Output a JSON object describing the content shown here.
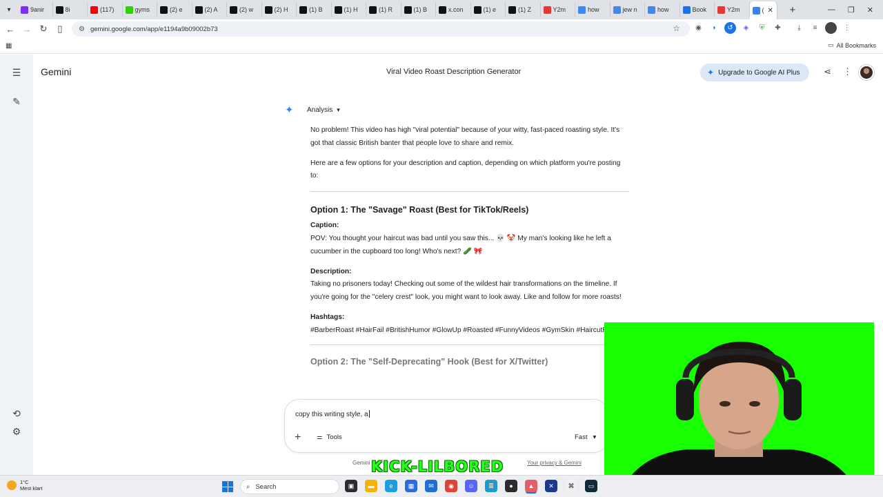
{
  "browser": {
    "tabs": [
      {
        "label": "9anir",
        "icon": "play-icon",
        "color": "#7b2ff7"
      },
      {
        "label": "8i",
        "icon": "tiktok-icon",
        "color": "#111111"
      },
      {
        "label": "(117)",
        "icon": "youtube-icon",
        "color": "#ff0000"
      },
      {
        "label": "gyms",
        "icon": "kick-icon",
        "color": "#2bd400"
      },
      {
        "label": "(2) e",
        "icon": "x-icon",
        "color": "#111111"
      },
      {
        "label": "(2) A",
        "icon": "x-icon",
        "color": "#111111"
      },
      {
        "label": "(2) w",
        "icon": "x-icon",
        "color": "#111111"
      },
      {
        "label": "(2) H",
        "icon": "x-icon",
        "color": "#111111"
      },
      {
        "label": "(1) B",
        "icon": "x-icon",
        "color": "#111111"
      },
      {
        "label": "(1) H",
        "icon": "x-icon",
        "color": "#111111"
      },
      {
        "label": "(1) R",
        "icon": "x-icon",
        "color": "#111111"
      },
      {
        "label": "(1) B",
        "icon": "x-icon",
        "color": "#111111"
      },
      {
        "label": "x.con",
        "icon": "x-icon",
        "color": "#111111"
      },
      {
        "label": "(1) e",
        "icon": "x-icon",
        "color": "#111111"
      },
      {
        "label": "(1) Z",
        "icon": "x-icon",
        "color": "#111111"
      },
      {
        "label": "Y2m",
        "icon": "y2mate-icon",
        "color": "#e53935"
      },
      {
        "label": "how",
        "icon": "google-icon",
        "color": "#4285f4"
      },
      {
        "label": "jew n",
        "icon": "google-icon",
        "color": "#4285f4"
      },
      {
        "label": "how",
        "icon": "google-icon",
        "color": "#4285f4"
      },
      {
        "label": "Book",
        "icon": "star-icon",
        "color": "#1a73e8"
      },
      {
        "label": "Y2m",
        "icon": "y2mate-icon",
        "color": "#e53935"
      },
      {
        "label": "(",
        "icon": "gemini-icon",
        "color": "#3b82f6",
        "active": true
      }
    ],
    "url": "gemini.google.com/app/e1194a9b09002b73",
    "all_bookmarks": "All Bookmarks"
  },
  "gemini": {
    "brand": "Gemini",
    "conversation_title": "Viral Video Roast Description Generator",
    "upgrade_label": "Upgrade to Google AI Plus",
    "model_label": "Analysis",
    "response": {
      "intro_1": "No problem! This video has high \"viral potential\" because of your witty, fast-paced roasting style. It's got that classic British banter that people love to share and remix.",
      "intro_2": "Here are a few options for your description and caption, depending on which platform you're posting to:",
      "option1_title": "Option 1: The \"Savage\" Roast (Best for TikTok/Reels)",
      "caption_label": "Caption:",
      "caption_text": "POV: You thought your haircut was bad until you saw this... 💀 🤡 My man's looking like he left a cucumber in the cupboard too long! Who's next? 🥒 🎀",
      "description_label": "Description:",
      "description_text": "Taking no prisoners today! Checking out some of the wildest hair transformations on the timeline. If you're going for the \"celery crest\" look, you might want to look away. Like and follow for more roasts!",
      "hashtags_label": "Hashtags:",
      "hashtags_text": "#BarberRoast #HairFail #BritishHumor #GlowUp #Roasted #FunnyVideos #GymSkin #HaircutReview",
      "option2_title": "Option 2: The \"Self-Deprecating\" Hook (Best for X/Twitter)"
    },
    "composer": {
      "typed_text": "copy this writing style, a",
      "tools_label": "Tools",
      "mode_label": "Fast"
    },
    "disclaimer": "Gemini",
    "privacy_link": "Your privacy & Gemini"
  },
  "overlay": {
    "watermark": "KICK-LILBORED"
  },
  "taskbar": {
    "temperature": "1°C",
    "weather": "Mest klart",
    "search_placeholder": "Search"
  }
}
